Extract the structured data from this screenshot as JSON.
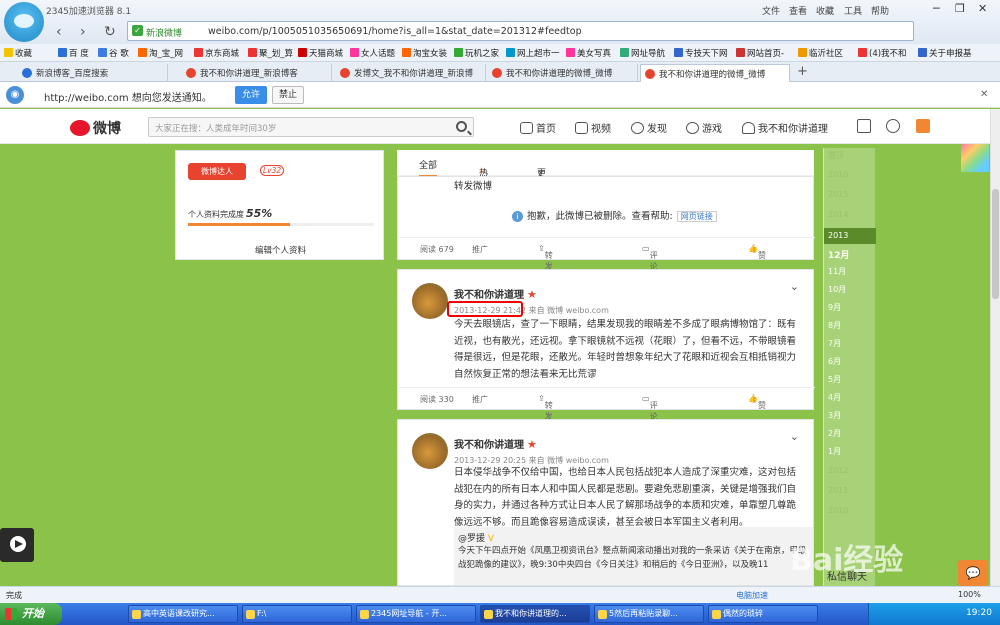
{
  "browser": {
    "app_name": "2345加速浏览器 8.1",
    "site_badge": "新浪微博",
    "url": "weibo.com/p/1005051035650691/home?is_all=1&stat_date=201312#feedtop",
    "menu": [
      "文件",
      "查看",
      "收藏",
      "工具",
      "帮助"
    ]
  },
  "bookmarks": [
    "收藏",
    "百 度",
    "谷 歌",
    "淘_宝_网",
    "京东商城",
    "聚_划_算",
    "天猫商城",
    "女人话题",
    "淘宝女装",
    "玩机之家",
    "网上超市一",
    "美女写真",
    "网址导航",
    "专技天下网",
    "网站首页-",
    "临沂社区",
    "(4)我不和",
    "关于申报基"
  ],
  "tabs": [
    "新浪博客_百度搜索",
    "我不和你讲道理_新浪博客",
    "发博文_我不和你讲道理_新浪博",
    "我不和你讲道理的微博_微博",
    "我不和你讲道理的微博_微博"
  ],
  "notification": {
    "text": "http://weibo.com 想向您发送通知。",
    "allow": "允许",
    "deny": "禁止"
  },
  "weibo": {
    "logo": "微博",
    "search_placeholder": "大家正在搜：人类成年时间30岁",
    "nav": [
      "首页",
      "视频",
      "发现",
      "游戏",
      "我不和你讲道理"
    ]
  },
  "profile": {
    "badge": "微博达人",
    "level": "Lv32",
    "completion_label": "个人资料完成度",
    "completion_value": "55%",
    "completion_fraction": 0.55,
    "edit_label": "编辑个人资料"
  },
  "feed_tabs": [
    "全部",
    "热门",
    "更多"
  ],
  "posts": [
    {
      "text": "转发微博",
      "deleted_notice": "抱歉，此微博已被删除。查看帮助:",
      "help_link": "网页链接",
      "reads": "阅读 679",
      "actions": [
        "推广",
        "转发",
        "评论",
        "赞"
      ]
    },
    {
      "username": "我不和你讲道理",
      "time": "2013-12-29 21:42",
      "source": "来自 微博 weibo.com",
      "text": "今天去眼镜店，查了一下眼睛，结果发现我的眼睛差不多成了眼病博物馆了：既有近视，也有散光，还远视。拿下眼镜就不远视（花眼）了，但看不远，不带眼镜看得是很远，但是花眼，还散光。年轻时曾想象年纪大了花眼和近视会互相抵销视力自然恢复正常的想法看来无比荒谬",
      "reads": "阅读 330",
      "actions": [
        "推广",
        "转发",
        "评论",
        "赞"
      ]
    },
    {
      "username": "我不和你讲道理",
      "time": "2013-12-29 20:25",
      "source": "来自 微博 weibo.com",
      "text": "日本侵华战争不仅给中国，也给日本人民包括战犯本人造成了深重灾难，这对包括战犯在内的所有日本人和中国人民都是悲剧。要避免悲剧重演，关键是增强我们自身的实力，并通过各种方式让日本人民了解那场战争的本质和灾难，单靠塑几尊跪像远远不够。而且跪像容易造成误读，甚至会被日本军国主义者利用。",
      "quote_author": "@罗援",
      "quote_text": "今天下午四点开始《凤凰卫视资讯台》整点新闻滚动播出对我的一条采访《关于在南京，甲级战犯跪像的建议》，晚9:30中央四台《今日关注》和稍后的《今日亚洲》，以及晚11"
    }
  ],
  "timeline": [
    "置顶",
    "2016",
    "2015",
    "2014",
    "2013",
    "12月",
    "11月",
    "10月",
    "9月",
    "8月",
    "7月",
    "6月",
    "5月",
    "4月",
    "3月",
    "2月",
    "1月",
    "2012",
    "2011",
    "2010"
  ],
  "side": {
    "private_msg": "私信聊天"
  },
  "watermark": "Bai经验",
  "statusbar": {
    "left": "完成",
    "accel": "电脑加速",
    "zoom": "100%"
  },
  "taskbar": {
    "start": "开始",
    "items": [
      "高中英语课改研究...",
      "F:\\",
      "2345网址导航 - 开...",
      "我不和你讲道理的...",
      "5然后再粘贴录聊...",
      "偶然的琐碎"
    ],
    "clock": "19:20"
  }
}
